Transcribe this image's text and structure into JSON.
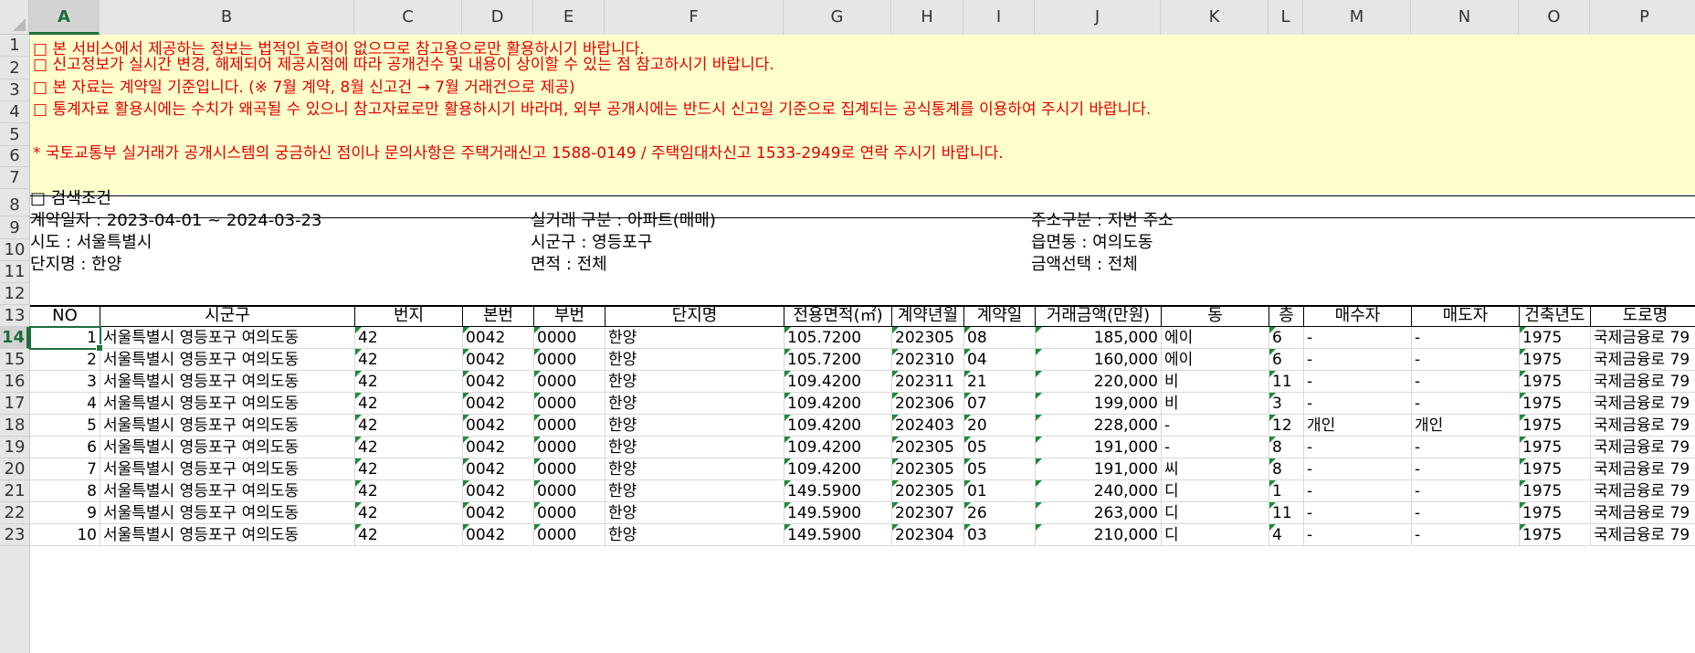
{
  "columns": [
    "A",
    "B",
    "C",
    "D",
    "E",
    "F",
    "G",
    "H",
    "I",
    "J",
    "K",
    "L",
    "M",
    "N",
    "O",
    "P"
  ],
  "active_column": "A",
  "active_row": "14",
  "row_numbers": [
    "1",
    "2",
    "3",
    "4",
    "5",
    "6",
    "7",
    "8",
    "9",
    "10",
    "11",
    "12",
    "13",
    "14",
    "15",
    "16",
    "17",
    "18",
    "19",
    "20",
    "21",
    "22",
    "23"
  ],
  "notices": [
    "□ 본 서비스에서 제공하는 정보는 법적인 효력이 없으므로 참고용으로만 활용하시기 바랍니다.",
    "□ 신고정보가 실시간 변경, 해제되어 제공시점에 따라 공개건수 및 내용이 상이할 수 있는 점 참고하시기 바랍니다.",
    "□ 본 자료는 계약일 기준입니다. (※ 7월 계약, 8월 신고건 → 7월 거래건으로  제공)",
    "□ 통계자료 활용시에는 수치가 왜곡될 수 있으니 참고자료로만 활용하시기  바라며,  외부 공개시에는 반드시 신고일 기준으로 집계되는 공식통계를 이용하여 주시기 바랍니다.",
    "* 국토교통부 실거래가 공개시스템의 궁금하신 점이나 문의사항은 주택거래신고 1588-0149 / 주택임대차신고 1533-2949로 연락 주시기 바랍니다."
  ],
  "search": {
    "title": "□ 검색조건",
    "contract_date": "계약일자 : 2023-04-01 ~ 2024-03-23",
    "deal_type": "실거래 구분 : 아파트(매매)",
    "address_type": "주소구분 : 지번 주소",
    "sido": "시도 : 서울특별시",
    "sigungu": "시군구 : 영등포구",
    "dong": "읍면동 : 여의도동",
    "complex": "단지명 : 한양",
    "area": "면적 : 전체",
    "amount": "금액선택 : 전체"
  },
  "table": {
    "headers": [
      "NO",
      "시군구",
      "번지",
      "본번",
      "부번",
      "단지명",
      "전용면적(㎡)",
      "계약년월",
      "계약일",
      "거래금액(만원)",
      "동",
      "층",
      "매수자",
      "매도자",
      "건축년도",
      "도로명"
    ],
    "rows": [
      [
        "1",
        "서울특별시 영등포구 여의도동",
        "42",
        "0042",
        "0000",
        "한양",
        "105.7200",
        "202305",
        "08",
        "185,000",
        "에이",
        "6",
        "-",
        "-",
        "1975",
        "국제금융로 79"
      ],
      [
        "2",
        "서울특별시 영등포구 여의도동",
        "42",
        "0042",
        "0000",
        "한양",
        "105.7200",
        "202310",
        "04",
        "160,000",
        "에이",
        "6",
        "-",
        "-",
        "1975",
        "국제금융로 79"
      ],
      [
        "3",
        "서울특별시 영등포구 여의도동",
        "42",
        "0042",
        "0000",
        "한양",
        "109.4200",
        "202311",
        "21",
        "220,000",
        "비",
        "11",
        "-",
        "-",
        "1975",
        "국제금융로 79"
      ],
      [
        "4",
        "서울특별시 영등포구 여의도동",
        "42",
        "0042",
        "0000",
        "한양",
        "109.4200",
        "202306",
        "07",
        "199,000",
        "비",
        "3",
        "-",
        "-",
        "1975",
        "국제금융로 79"
      ],
      [
        "5",
        "서울특별시 영등포구 여의도동",
        "42",
        "0042",
        "0000",
        "한양",
        "109.4200",
        "202403",
        "20",
        "228,000",
        "-",
        "12",
        "개인",
        "개인",
        "1975",
        "국제금융로 79"
      ],
      [
        "6",
        "서울특별시 영등포구 여의도동",
        "42",
        "0042",
        "0000",
        "한양",
        "109.4200",
        "202305",
        "05",
        "191,000",
        "-",
        "8",
        "-",
        "-",
        "1975",
        "국제금융로 79"
      ],
      [
        "7",
        "서울특별시 영등포구 여의도동",
        "42",
        "0042",
        "0000",
        "한양",
        "109.4200",
        "202305",
        "05",
        "191,000",
        "씨",
        "8",
        "-",
        "-",
        "1975",
        "국제금융로 79"
      ],
      [
        "8",
        "서울특별시 영등포구 여의도동",
        "42",
        "0042",
        "0000",
        "한양",
        "149.5900",
        "202305",
        "01",
        "240,000",
        "디",
        "1",
        "-",
        "-",
        "1975",
        "국제금융로 79"
      ],
      [
        "9",
        "서울특별시 영등포구 여의도동",
        "42",
        "0042",
        "0000",
        "한양",
        "149.5900",
        "202307",
        "26",
        "263,000",
        "디",
        "11",
        "-",
        "-",
        "1975",
        "국제금융로 79"
      ],
      [
        "10",
        "서울특별시 영등포구 여의도동",
        "42",
        "0042",
        "0000",
        "한양",
        "149.5900",
        "202304",
        "03",
        "210,000",
        "디",
        "4",
        "-",
        "-",
        "1975",
        "국제금융로 79"
      ]
    ]
  }
}
